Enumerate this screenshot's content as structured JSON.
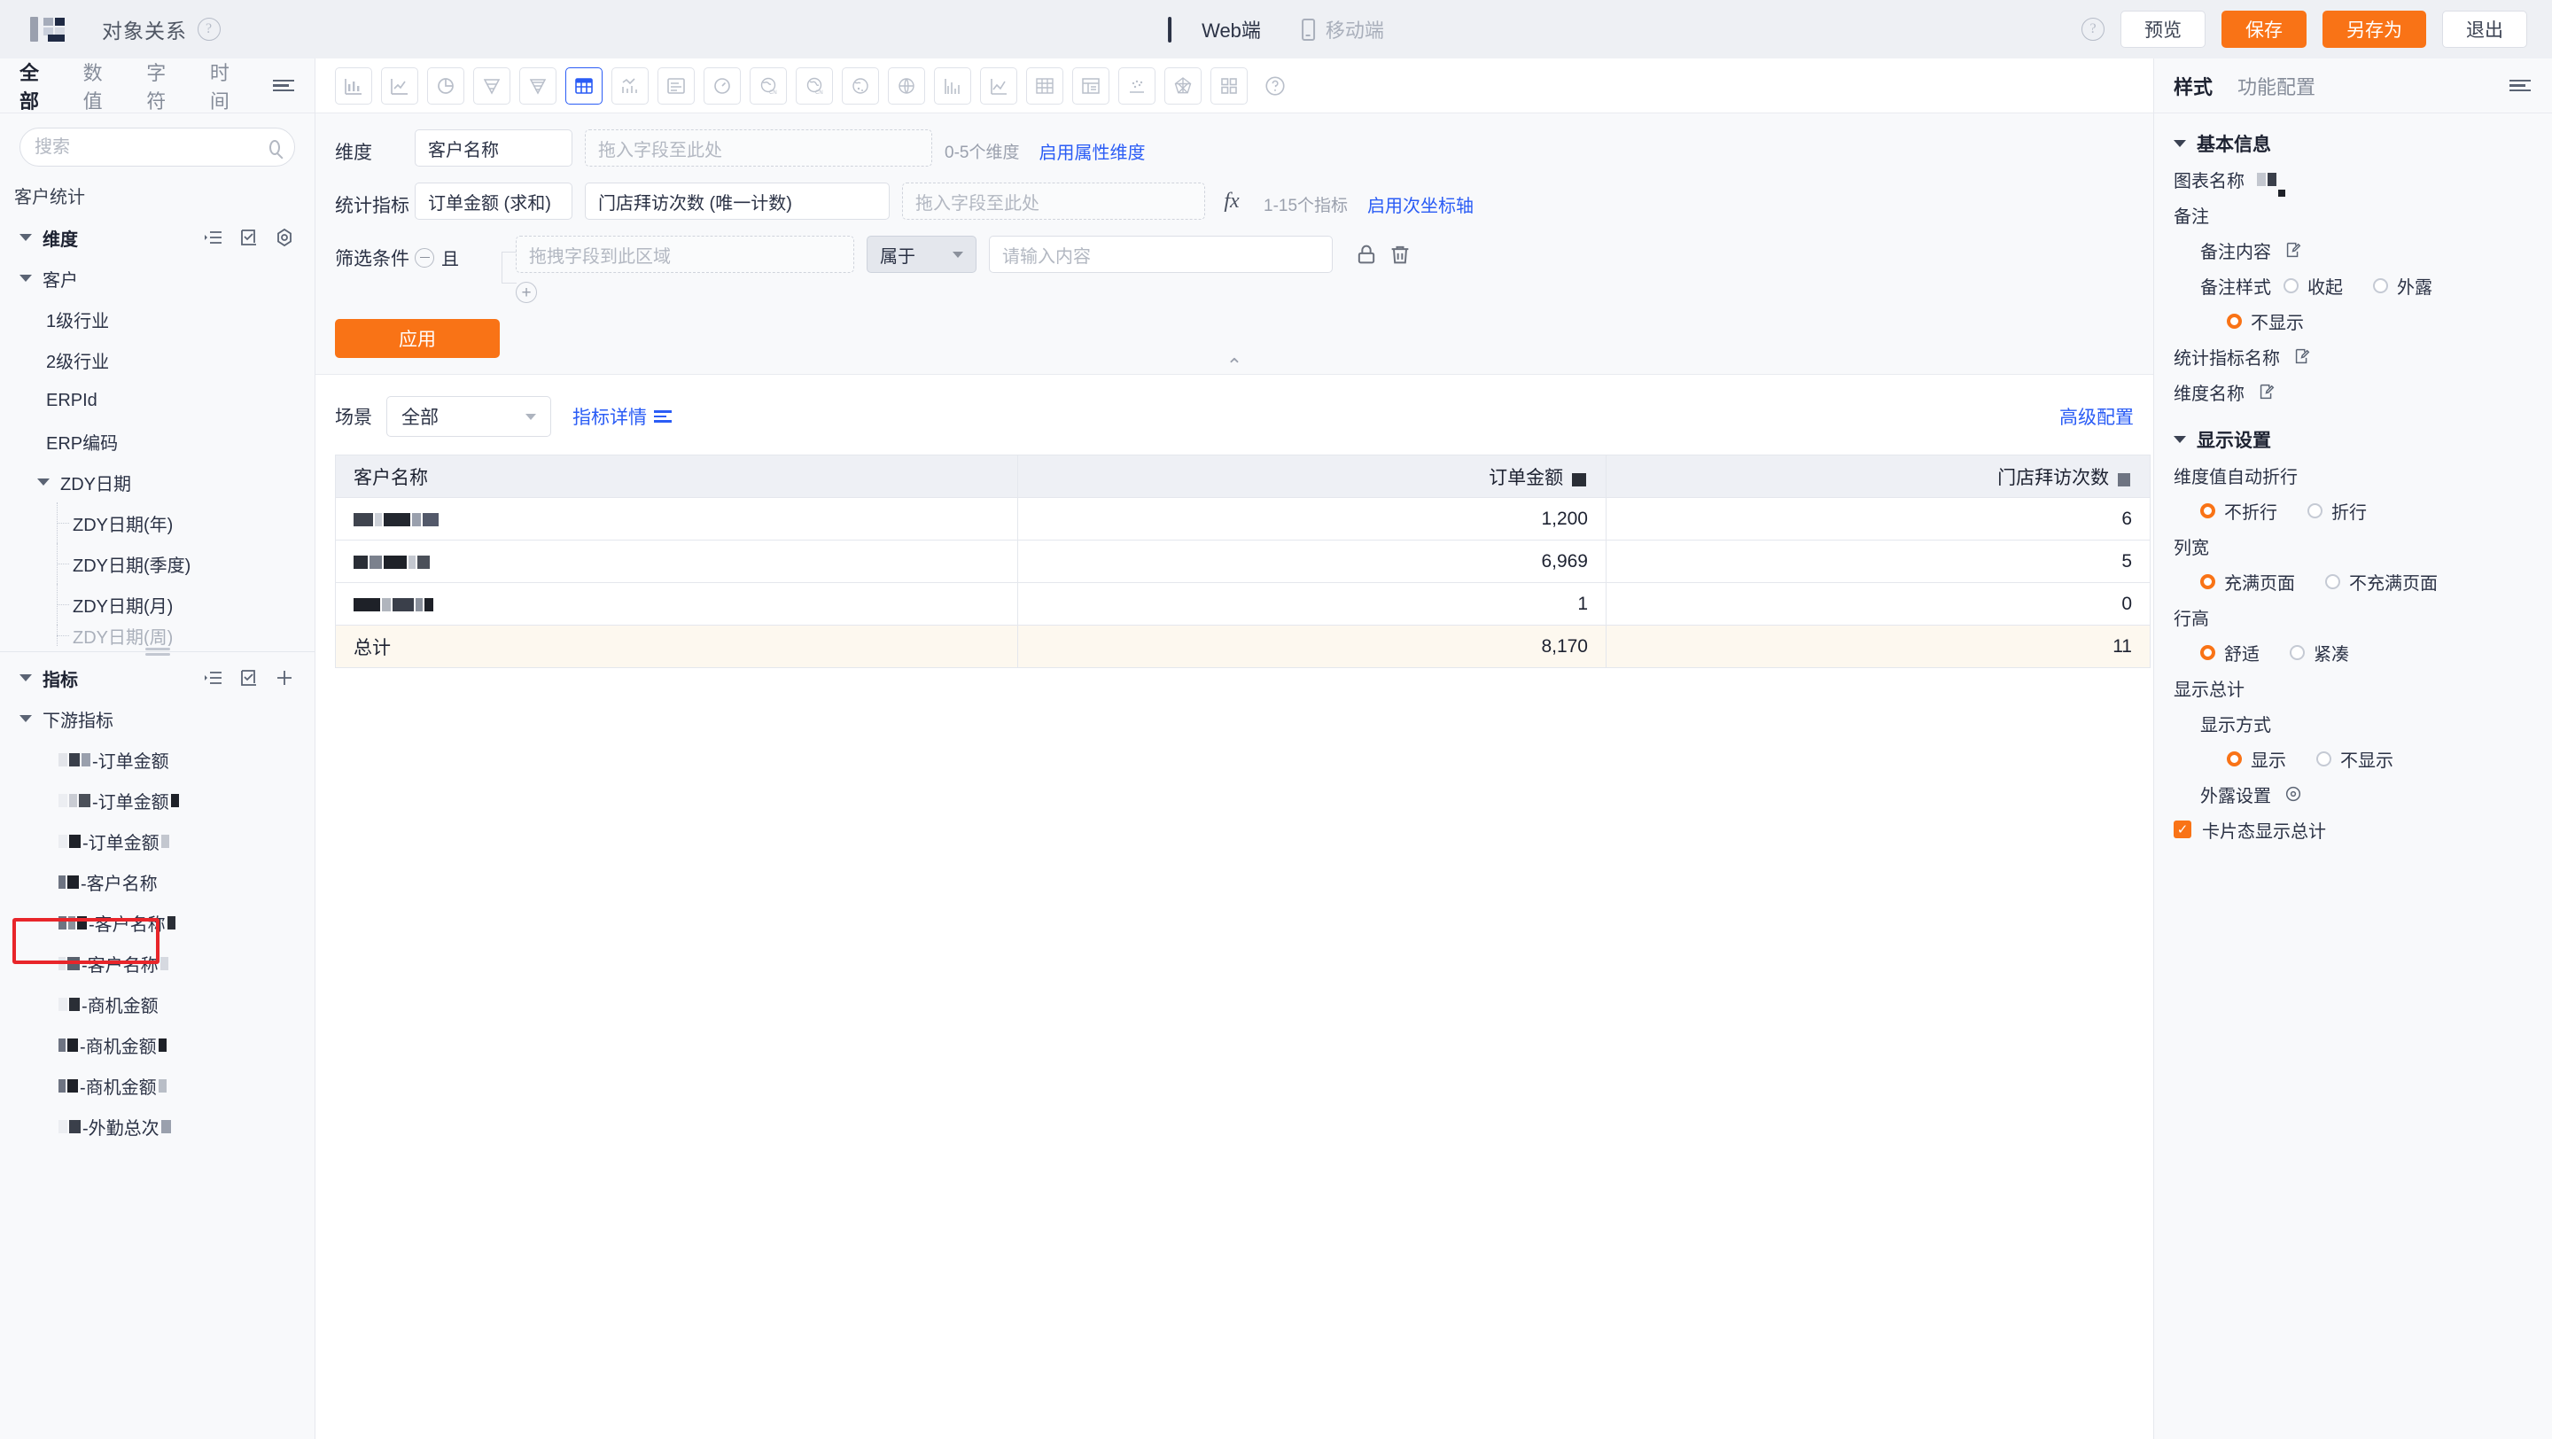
{
  "topbar": {
    "logo_icon": "app-logo-icon",
    "title": "对象关系",
    "help_icon": "help-circle-icon",
    "devices": [
      {
        "label": "Web端",
        "icon": "monitor-icon",
        "active": true
      },
      {
        "label": "移动端",
        "icon": "phone-icon",
        "active": false
      }
    ],
    "help_right_icon": "help-circle-icon",
    "buttons": [
      {
        "label": "预览",
        "style": "default"
      },
      {
        "label": "保存",
        "style": "primary"
      },
      {
        "label": "另存为",
        "style": "primary"
      },
      {
        "label": "退出",
        "style": "default"
      }
    ]
  },
  "sidebar": {
    "tabs": [
      {
        "label": "全部",
        "active": true
      },
      {
        "label": "数值",
        "active": false
      },
      {
        "label": "字符",
        "active": false
      },
      {
        "label": "时间",
        "active": false
      }
    ],
    "tab_menu_icon": "filter-list-icon",
    "search": {
      "value": "",
      "placeholder": "搜索",
      "icon": "search-icon"
    },
    "root_label": "客户统计",
    "dimension_group": {
      "label": "维度",
      "actions": [
        "indent-list-icon",
        "checkbox-list-icon",
        "settings-hex-icon"
      ]
    },
    "customer_group": {
      "label": "客户"
    },
    "customer_fields": [
      "1级行业",
      "2级行业",
      "ERPId",
      "ERP编码"
    ],
    "zdy_group": {
      "label": "ZDY日期"
    },
    "zdy_fields": [
      "ZDY日期(年)",
      "ZDY日期(季度)",
      "ZDY日期(月)",
      "ZDY日期(周)"
    ],
    "metric_group": {
      "label": "指标",
      "actions": [
        "indent-list-icon",
        "checkbox-list-icon",
        "plus-icon"
      ]
    },
    "downstream_group": {
      "label": "下游指标",
      "highlighted": true
    },
    "downstream_items": [
      "-订单金额",
      "-订单金额",
      "-订单金额",
      "-客户名称",
      "-客户名称",
      "-客户名称",
      "-商机金额",
      "-商机金额",
      "-商机金额",
      "-外勤总次"
    ]
  },
  "chart_types": {
    "items": [
      {
        "name": "bar-chart-icon",
        "selected": false
      },
      {
        "name": "line-chart-icon",
        "selected": false
      },
      {
        "name": "pie-chart-icon",
        "selected": false
      },
      {
        "name": "funnel-chart-icon",
        "selected": false
      },
      {
        "name": "funnel-compare-icon",
        "selected": false
      },
      {
        "name": "table-chart-icon",
        "selected": true
      },
      {
        "name": "combo-chart-icon",
        "selected": false
      },
      {
        "name": "text-card-icon",
        "selected": false
      },
      {
        "name": "gauge-chart-icon",
        "selected": false
      },
      {
        "name": "map-china-icon",
        "selected": false
      },
      {
        "name": "map-china-heat-icon",
        "selected": false
      },
      {
        "name": "map-world-bubble-icon",
        "selected": false
      },
      {
        "name": "map-world-icon",
        "selected": false
      },
      {
        "name": "grouped-bar-icon",
        "selected": false
      },
      {
        "name": "area-line-icon",
        "selected": false
      },
      {
        "name": "pivot-table-icon",
        "selected": false
      },
      {
        "name": "detail-table-icon",
        "selected": false
      },
      {
        "name": "scatter-chart-icon",
        "selected": false
      },
      {
        "name": "radar-chart-icon",
        "selected": false
      },
      {
        "name": "dashboard-grid-icon",
        "selected": false
      },
      {
        "name": "help-circle-icon",
        "selected": false
      }
    ]
  },
  "config": {
    "dimension": {
      "label": "维度",
      "chips": [
        "客户名称"
      ],
      "dropzone_placeholder": "拖入字段至此处",
      "hint": "0-5个维度",
      "link": "启用属性维度"
    },
    "metric": {
      "label": "统计指标",
      "chips": [
        "订单金额 (求和)",
        "门店拜访次数 (唯一计数)"
      ],
      "dropzone_placeholder": "拖入字段至此处",
      "fx_icon": "fx-icon",
      "hint": "1-15个指标",
      "link": "启用次坐标轴"
    },
    "filter": {
      "label": "筛选条件",
      "minus_icon": "minus-circle-icon",
      "logic": "且",
      "field_placeholder": "拖拽字段到此区域",
      "operator": "属于",
      "value_placeholder": "请输入内容",
      "lock_icon": "lock-icon",
      "trash_icon": "trash-icon",
      "add_icon": "plus-circle-icon"
    },
    "apply_label": "应用",
    "collapse_icon": "chevron-up-icon"
  },
  "result": {
    "scene_label": "场景",
    "scene_value": "全部",
    "detail_link": "指标详情",
    "detail_icon": "list-icon",
    "advanced_link": "高级配置"
  },
  "chart_data": {
    "type": "table",
    "title": "",
    "columns": [
      "客户名称",
      "订单金额",
      "门店拜访次数"
    ],
    "column_align": [
      "left",
      "right",
      "right"
    ],
    "rows": [
      {
        "客户名称": "",
        "订单金额": "1,200",
        "门店拜访次数": "6"
      },
      {
        "客户名称": "",
        "订单金额": "6,969",
        "门店拜访次数": "5"
      },
      {
        "客户名称": "",
        "订单金额": "1",
        "门店拜访次数": "0"
      }
    ],
    "total_row": {
      "label": "总计",
      "订单金额": "8,170",
      "门店拜访次数": "11"
    },
    "legend": [],
    "notes": "Customer name cells are redacted/blurred in the source screenshot"
  },
  "rightpanel": {
    "tabs": [
      {
        "label": "样式",
        "active": true
      },
      {
        "label": "功能配置",
        "active": false
      }
    ],
    "collapse_icon": "collapse-panel-icon",
    "basic_info": {
      "title": "基本信息",
      "chart_name_label": "图表名称",
      "chart_name_value": "",
      "remark_label": "备注",
      "remark_content_label": "备注内容",
      "remark_content_icon": "edit-icon",
      "remark_style_label": "备注样式",
      "remark_style_options": [
        {
          "label": "收起",
          "selected": false
        },
        {
          "label": "外露",
          "selected": false
        },
        {
          "label": "不显示",
          "selected": true
        }
      ],
      "metric_name_label": "统计指标名称",
      "metric_name_icon": "edit-icon",
      "dimension_name_label": "维度名称",
      "dimension_name_icon": "edit-icon"
    },
    "display_settings": {
      "title": "显示设置",
      "wrap_label": "维度值自动折行",
      "wrap_options": [
        {
          "label": "不折行",
          "selected": true
        },
        {
          "label": "折行",
          "selected": false
        }
      ],
      "colwidth_label": "列宽",
      "colwidth_options": [
        {
          "label": "充满页面",
          "selected": true
        },
        {
          "label": "不充满页面",
          "selected": false
        }
      ],
      "rowheight_label": "行高",
      "rowheight_options": [
        {
          "label": "舒适",
          "selected": true
        },
        {
          "label": "紧凑",
          "selected": false
        }
      ],
      "total_label": "显示总计",
      "total_mode_label": "显示方式",
      "total_mode_options": [
        {
          "label": "显示",
          "selected": true
        },
        {
          "label": "不显示",
          "selected": false
        }
      ],
      "expose_label": "外露设置",
      "expose_icon": "gear-icon",
      "card_total_label": "卡片态显示总计",
      "card_total_checked": true
    }
  },
  "colors": {
    "accent_orange": "#f97316",
    "link_blue": "#2a5cf5",
    "highlight_red": "#e8252a",
    "total_row_bg": "#fdf8ef",
    "header_bg": "#eef0f5"
  }
}
